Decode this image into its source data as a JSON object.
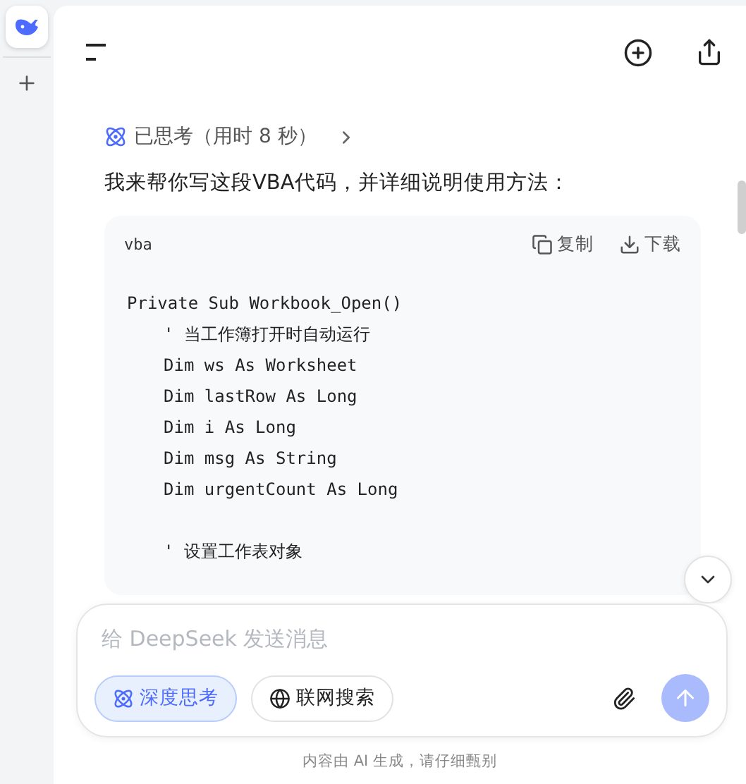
{
  "thinking": {
    "label": "已思考（用时 8 秒）",
    "expanded": false
  },
  "intro": "我来帮你写这段VBA代码，并详细说明使用方法：",
  "code_block": {
    "language": "vba",
    "actions": [
      {
        "kind": "copy",
        "label": "复制"
      },
      {
        "kind": "download",
        "label": "下载"
      }
    ],
    "lines": [
      {
        "kind": "code",
        "text": "Private Sub Workbook_Open()",
        "indented": false
      },
      {
        "kind": "code",
        "text": "' 当工作簿打开时自动运行",
        "indented": true
      },
      {
        "kind": "code",
        "text": "Dim ws As Worksheet",
        "indented": true
      },
      {
        "kind": "code",
        "text": "Dim lastRow As Long",
        "indented": true
      },
      {
        "kind": "code",
        "text": "Dim i As Long",
        "indented": true
      },
      {
        "kind": "code",
        "text": "Dim msg As String",
        "indented": true
      },
      {
        "kind": "code",
        "text": "Dim urgentCount As Long",
        "indented": true
      },
      {
        "kind": "blank"
      },
      {
        "kind": "code",
        "text": "' 设置工作表对象",
        "indented": true
      }
    ]
  },
  "composer": {
    "placeholder": "给 DeepSeek 发送消息",
    "toggles": [
      {
        "kind": "think",
        "label": "深度思考",
        "selected": true
      },
      {
        "kind": "search",
        "label": "联网搜索",
        "selected": false
      }
    ],
    "send_disabled": true
  },
  "footer": "内容由 AI 生成，请仔细甄别"
}
